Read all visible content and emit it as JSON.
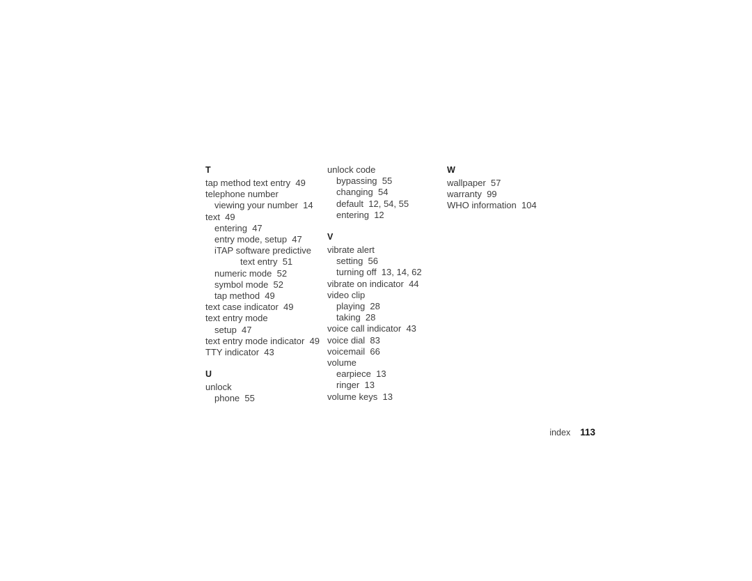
{
  "document": {
    "kind": "index-page",
    "background_color": "#ffffff",
    "text_color": "#3d3d3d",
    "heading_color": "#1c1c1c"
  },
  "columns": [
    {
      "id": "column-1",
      "sections": [
        {
          "letter": "T",
          "entries": [
            {
              "text": "tap method text entry  49",
              "level": 0
            },
            {
              "text": "telephone number",
              "level": 0
            },
            {
              "text": "viewing your number  14",
              "level": 1
            },
            {
              "text": "text  49",
              "level": 0
            },
            {
              "text": "entering  47",
              "level": 1
            },
            {
              "text": "entry mode, setup  47",
              "level": 1
            },
            {
              "text": "iTAP software predictive",
              "level": 1
            },
            {
              "text": "text entry  51",
              "level": 2
            },
            {
              "text": "numeric mode  52",
              "level": 1
            },
            {
              "text": "symbol mode  52",
              "level": 1
            },
            {
              "text": "tap method  49",
              "level": 1
            },
            {
              "text": "text case indicator  49",
              "level": 0
            },
            {
              "text": "text entry mode",
              "level": 0
            },
            {
              "text": "setup  47",
              "level": 1
            },
            {
              "text": "text entry mode indicator  49",
              "level": 0
            },
            {
              "text": "TTY indicator  43",
              "level": 0
            }
          ]
        },
        {
          "letter": "U",
          "entries": [
            {
              "text": "unlock",
              "level": 0
            },
            {
              "text": "phone  55",
              "level": 1
            }
          ]
        }
      ]
    },
    {
      "id": "column-2",
      "sections": [
        {
          "letter": "",
          "entries": [
            {
              "text": "unlock code",
              "level": 0
            },
            {
              "text": "bypassing  55",
              "level": 1
            },
            {
              "text": "changing  54",
              "level": 1
            },
            {
              "text": "default  12, 54, 55",
              "level": 1
            },
            {
              "text": "entering  12",
              "level": 1
            }
          ]
        },
        {
          "letter": "V",
          "entries": [
            {
              "text": "vibrate alert",
              "level": 0
            },
            {
              "text": "setting  56",
              "level": 1
            },
            {
              "text": "turning off  13, 14, 62",
              "level": 1
            },
            {
              "text": "vibrate on indicator  44",
              "level": 0
            },
            {
              "text": "video clip",
              "level": 0
            },
            {
              "text": "playing  28",
              "level": 1
            },
            {
              "text": "taking  28",
              "level": 1
            },
            {
              "text": "voice call indicator  43",
              "level": 0
            },
            {
              "text": "voice dial  83",
              "level": 0
            },
            {
              "text": "voicemail  66",
              "level": 0
            },
            {
              "text": "volume",
              "level": 0
            },
            {
              "text": "earpiece  13",
              "level": 1
            },
            {
              "text": "ringer  13",
              "level": 1
            },
            {
              "text": "volume keys  13",
              "level": 0
            }
          ]
        }
      ]
    },
    {
      "id": "column-3",
      "sections": [
        {
          "letter": "W",
          "entries": [
            {
              "text": "wallpaper  57",
              "level": 0
            },
            {
              "text": "warranty  99",
              "level": 0
            },
            {
              "text": "WHO information  104",
              "level": 0
            }
          ]
        }
      ]
    }
  ],
  "footer": {
    "label": "index",
    "page_number": "113"
  }
}
